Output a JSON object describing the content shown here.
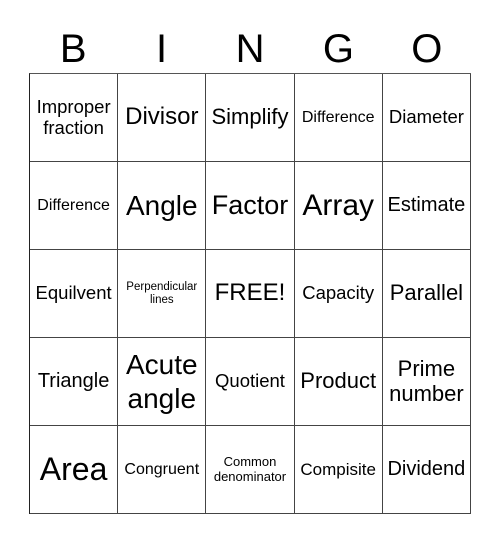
{
  "header": {
    "letters": [
      "B",
      "I",
      "N",
      "G",
      "O"
    ]
  },
  "cells": [
    [
      "Improper fraction",
      "Divisor",
      "Simplify",
      "Difference",
      "Diameter"
    ],
    [
      "Difference",
      "Angle",
      "Factor",
      "Array",
      "Estimate"
    ],
    [
      "Equilvent",
      "Perpendicular lines",
      "FREE!",
      "Capacity",
      "Parallel"
    ],
    [
      "Triangle",
      "Acute angle",
      "Quotient",
      "Product",
      "Prime number"
    ],
    [
      "Area",
      "Congruent",
      "Common denominator",
      "Compisite",
      "Dividend"
    ]
  ]
}
